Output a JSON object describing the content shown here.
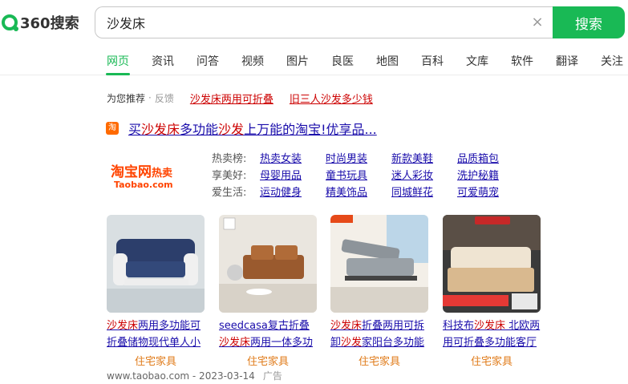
{
  "brand": {
    "logo_text": "360搜索"
  },
  "search": {
    "query": "沙发床",
    "button_label": "搜索"
  },
  "tabs": [
    "网页",
    "资讯",
    "问答",
    "视频",
    "图片",
    "良医",
    "地图",
    "百科",
    "文库",
    "软件",
    "翻译",
    "关注"
  ],
  "recommend": {
    "label": "为您推荐",
    "feedback": "反馈",
    "links": [
      "沙发床两用可折叠",
      "旧三人沙发多少钱"
    ]
  },
  "result": {
    "icon_text": "淘",
    "title_parts": [
      "买",
      "沙发床",
      "多功能",
      "沙发",
      "上万能的淘宝!优享品..."
    ],
    "logo": {
      "main": "淘宝网",
      "hot": "热卖",
      "sub": "Taobao.com"
    },
    "categories": [
      {
        "label": "热卖榜:",
        "links": [
          "热卖女装",
          "时尚男装",
          "新款美鞋",
          "品质箱包"
        ]
      },
      {
        "label": "享美好:",
        "links": [
          "母婴用品",
          "童书玩具",
          "迷人彩妆",
          "洗护秘籍"
        ]
      },
      {
        "label": "爱生活:",
        "links": [
          "运动健身",
          "精美饰品",
          "同城鲜花",
          "可爱萌宠"
        ]
      }
    ],
    "products": [
      {
        "desc_parts": [
          "沙发床",
          "两用多功能可折叠储物现代单人小"
        ],
        "shop": "住宅家具"
      },
      {
        "desc_parts": [
          "seedcasa复古折叠",
          "沙发床",
          "两用一体多功能"
        ],
        "shop": "住宅家具"
      },
      {
        "desc_parts": [
          "沙发床",
          "折叠两用可拆卸",
          "沙发",
          "家阳台多功能"
        ],
        "shop": "住宅家具"
      },
      {
        "desc_parts": [
          "科技布",
          "沙发床",
          " 北欧两用可折叠多功能客厅"
        ],
        "shop": "住宅家具"
      }
    ],
    "source": "www.taobao.com - 2023-03-14",
    "ad_label": "广告"
  },
  "colors": {
    "accent": "#19b955",
    "link": "#1a0dab",
    "highlight": "#cc0000",
    "shop": "#e07b1a"
  }
}
